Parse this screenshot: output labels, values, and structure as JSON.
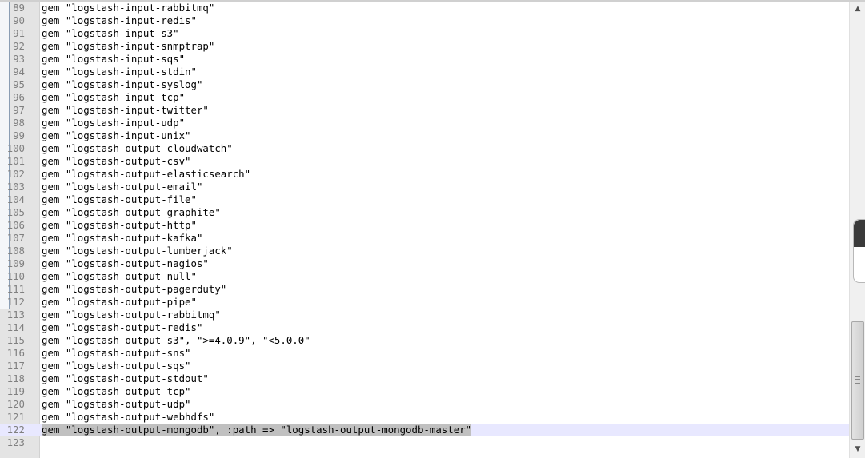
{
  "editor": {
    "lines": [
      {
        "number": "89",
        "text": "gem \"logstash-input-rabbitmq\""
      },
      {
        "number": "90",
        "text": "gem \"logstash-input-redis\""
      },
      {
        "number": "91",
        "text": "gem \"logstash-input-s3\""
      },
      {
        "number": "92",
        "text": "gem \"logstash-input-snmptrap\""
      },
      {
        "number": "93",
        "text": "gem \"logstash-input-sqs\""
      },
      {
        "number": "94",
        "text": "gem \"logstash-input-stdin\""
      },
      {
        "number": "95",
        "text": "gem \"logstash-input-syslog\""
      },
      {
        "number": "96",
        "text": "gem \"logstash-input-tcp\""
      },
      {
        "number": "97",
        "text": "gem \"logstash-input-twitter\""
      },
      {
        "number": "98",
        "text": "gem \"logstash-input-udp\""
      },
      {
        "number": "99",
        "text": "gem \"logstash-input-unix\""
      },
      {
        "number": "100",
        "text": "gem \"logstash-output-cloudwatch\""
      },
      {
        "number": "101",
        "text": "gem \"logstash-output-csv\""
      },
      {
        "number": "102",
        "text": "gem \"logstash-output-elasticsearch\""
      },
      {
        "number": "103",
        "text": "gem \"logstash-output-email\""
      },
      {
        "number": "104",
        "text": "gem \"logstash-output-file\""
      },
      {
        "number": "105",
        "text": "gem \"logstash-output-graphite\""
      },
      {
        "number": "106",
        "text": "gem \"logstash-output-http\""
      },
      {
        "number": "107",
        "text": "gem \"logstash-output-kafka\""
      },
      {
        "number": "108",
        "text": "gem \"logstash-output-lumberjack\""
      },
      {
        "number": "109",
        "text": "gem \"logstash-output-nagios\""
      },
      {
        "number": "110",
        "text": "gem \"logstash-output-null\""
      },
      {
        "number": "111",
        "text": "gem \"logstash-output-pagerduty\""
      },
      {
        "number": "112",
        "text": "gem \"logstash-output-pipe\""
      },
      {
        "number": "113",
        "text": "gem \"logstash-output-rabbitmq\""
      },
      {
        "number": "114",
        "text": "gem \"logstash-output-redis\""
      },
      {
        "number": "115",
        "text": "gem \"logstash-output-s3\", \">=4.0.9\", \"<5.0.0\""
      },
      {
        "number": "116",
        "text": "gem \"logstash-output-sns\""
      },
      {
        "number": "117",
        "text": "gem \"logstash-output-sqs\""
      },
      {
        "number": "118",
        "text": "gem \"logstash-output-stdout\""
      },
      {
        "number": "119",
        "text": "gem \"logstash-output-tcp\""
      },
      {
        "number": "120",
        "text": "gem \"logstash-output-udp\""
      },
      {
        "number": "121",
        "text": "gem \"logstash-output-webhdfs\""
      },
      {
        "number": "122",
        "text": "gem \"logstash-output-mongodb\", :path => \"logstash-output-mongodb-master\"",
        "current": true,
        "selected": true
      },
      {
        "number": "123",
        "text": ""
      }
    ]
  },
  "scrollbar": {
    "up_icon": "scroll-up-arrow",
    "down_icon": "scroll-down-arrow",
    "position_fraction": 0.83
  },
  "colors": {
    "gutter": "#e4e4e4",
    "current_line": "#e8e8ff",
    "selection": "#c0c0c0",
    "line_number": "#808080"
  }
}
